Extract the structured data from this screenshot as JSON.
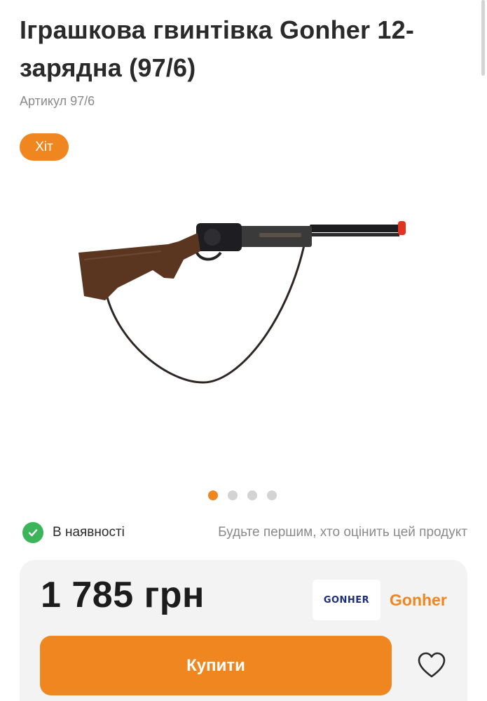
{
  "product": {
    "title": "Іграшкова гвинтівка Gonher 12-зарядна (97/6)",
    "sku_label": "Артикул 97/6",
    "badge": "Хіт",
    "image_alt": "rifle-image"
  },
  "gallery": {
    "slide_count": 4,
    "active_index": 0
  },
  "availability": {
    "label": "В наявності",
    "rating_text": "Будьте першим, хто оцінить цей продукт"
  },
  "purchase": {
    "price": "1 785 грн",
    "brand_logo_text": "GONHER",
    "brand_name": "Gonher",
    "buy_label": "Купити",
    "favorite_icon": "heart-icon"
  },
  "colors": {
    "accent": "#f0861f",
    "success": "#3cb55a",
    "muted_text": "#8a8a8a",
    "card_bg": "#f3f3f3"
  }
}
